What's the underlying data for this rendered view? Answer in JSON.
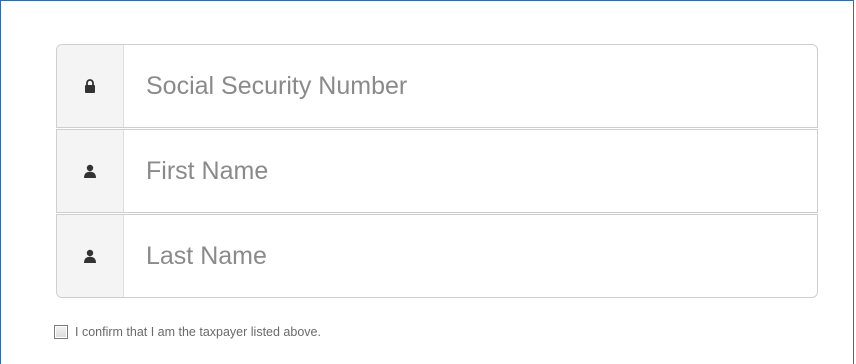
{
  "form": {
    "fields": [
      {
        "icon": "lock-icon",
        "placeholder": "Social Security Number",
        "value": ""
      },
      {
        "icon": "user-icon",
        "placeholder": "First Name",
        "value": ""
      },
      {
        "icon": "user-icon",
        "placeholder": "Last Name",
        "value": ""
      }
    ],
    "confirm": {
      "label": "I confirm that I am the taxpayer listed above.",
      "checked": false
    }
  },
  "colors": {
    "frame_border": "#3b6a9a",
    "field_border": "#cfcfcf",
    "addon_bg": "#f4f4f4",
    "icon": "#333333",
    "placeholder": "#8a8a8a"
  }
}
